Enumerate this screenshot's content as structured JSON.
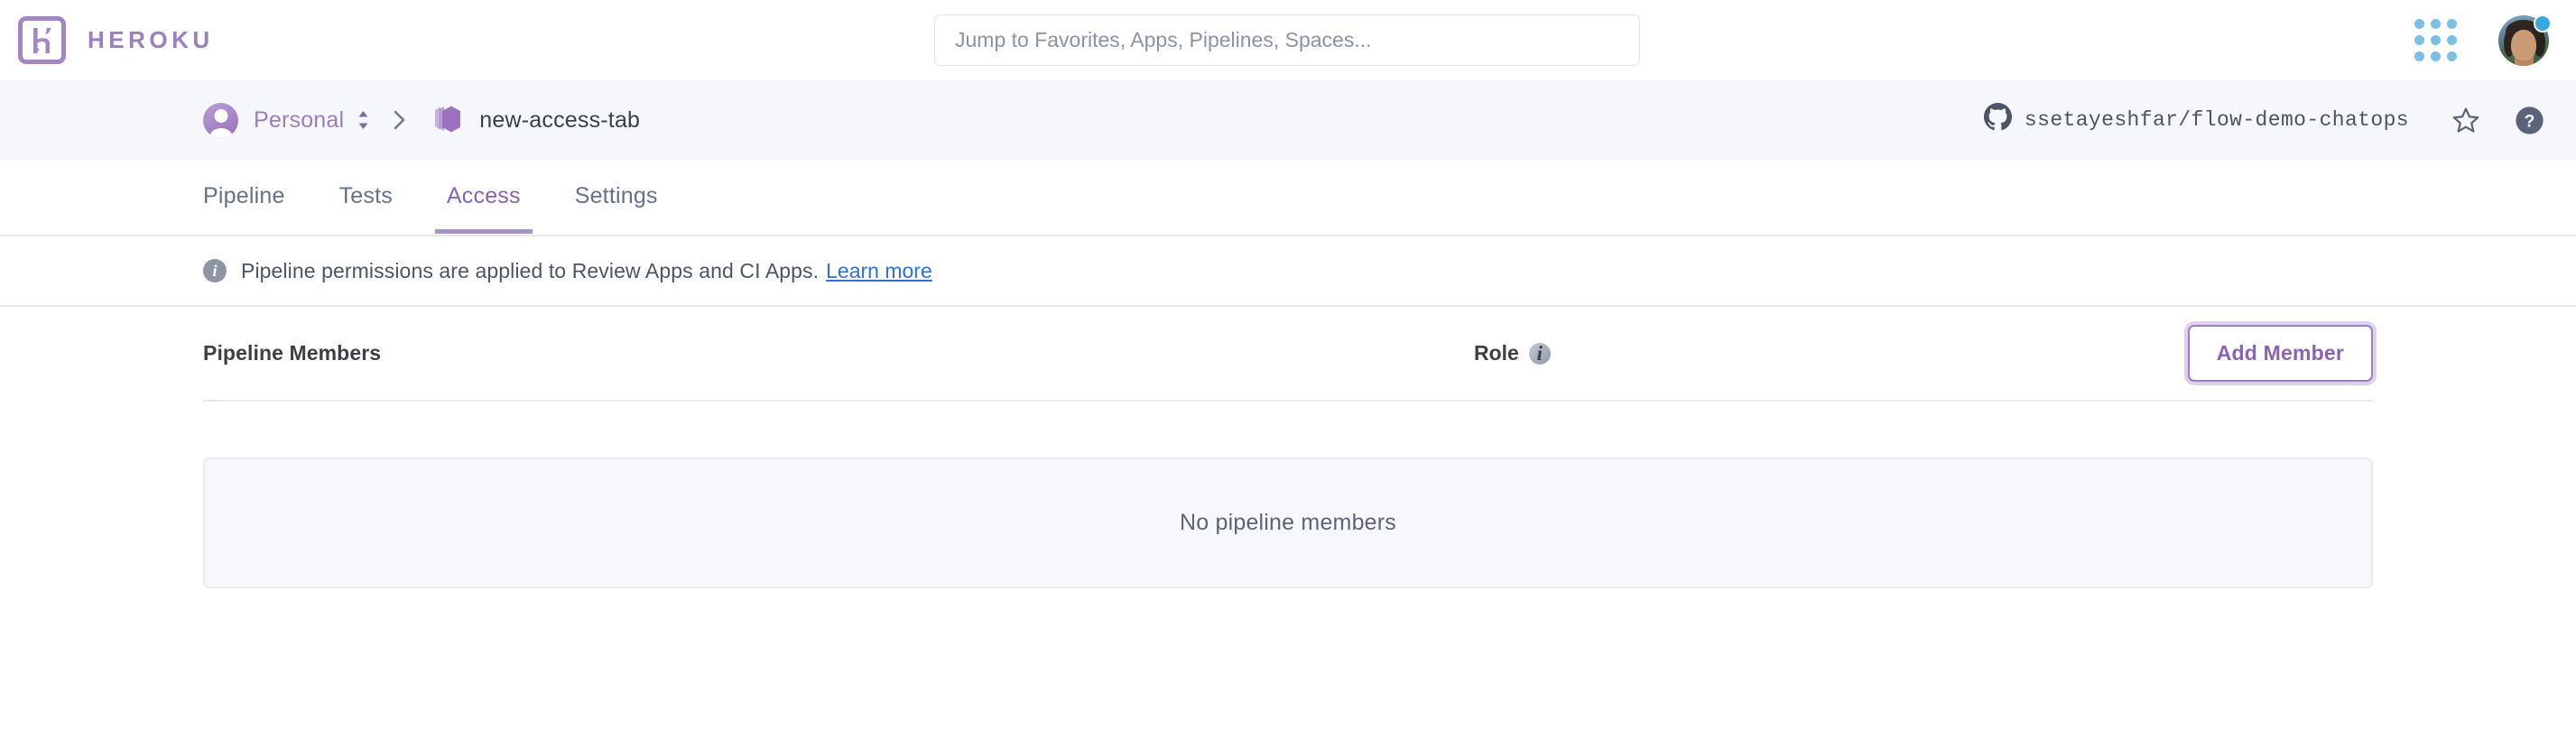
{
  "topnav": {
    "brand_name": "HEROKU",
    "logo_icon": "heroku-logo-icon",
    "search": {
      "placeholder": "Jump to Favorites, Apps, Pipelines, Spaces...",
      "value": ""
    },
    "apps_grid_icon": "apps-grid-icon",
    "avatar_icon": "user-avatar",
    "status_icon": "online-status-dot"
  },
  "breadcrumb": {
    "owner_avatar_icon": "personal-account-avatar-icon",
    "owner": "Personal",
    "switcher_icon": "chevron-up-down-icon",
    "separator_icon": "chevron-right-icon",
    "pipeline_icon": "pipeline-hexagon-icon",
    "pipeline_name": "new-access-tab",
    "github_icon": "github-icon",
    "repo": "ssetayeshfar/flow-demo-chatops",
    "favorite_icon": "star-outline-icon",
    "help_icon": "help-question-icon"
  },
  "tabs": [
    {
      "label": "Pipeline",
      "active": false
    },
    {
      "label": "Tests",
      "active": false
    },
    {
      "label": "Access",
      "active": true
    },
    {
      "label": "Settings",
      "active": false
    }
  ],
  "notice": {
    "icon": "info-icon",
    "text": "Pipeline permissions are applied to Review Apps and CI Apps.",
    "link_label": "Learn more"
  },
  "members_table": {
    "members_header": "Pipeline Members",
    "role_header": "Role",
    "role_info_icon": "info-icon",
    "add_member_label": "Add Member",
    "empty_state": "No pipeline members",
    "rows": []
  },
  "colors": {
    "brand_purple": "#9b7fc0",
    "accent_purple": "#8b63b5",
    "link_blue": "#2f6fd8",
    "text_dark": "#3b4049",
    "text_muted": "#63718b",
    "band_bg": "#f6f7fb",
    "status_blue": "#38a8e0"
  }
}
